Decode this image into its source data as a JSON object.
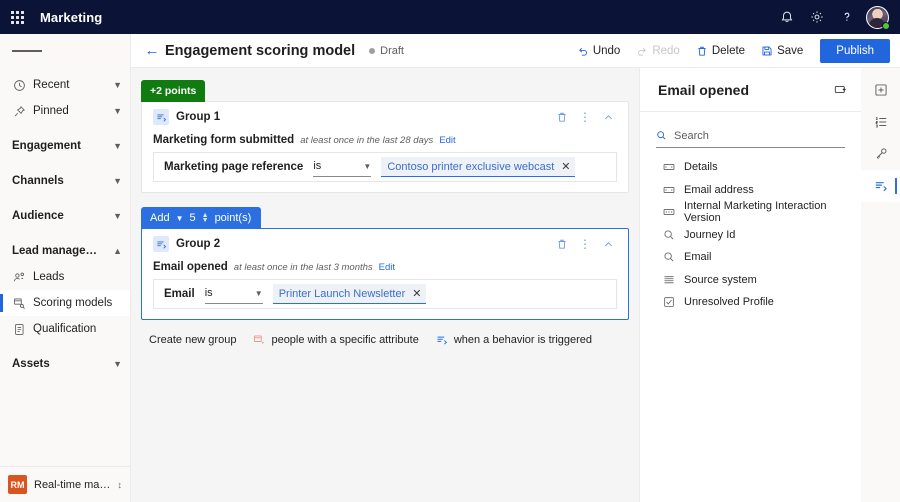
{
  "appbar": {
    "waffle_name": "app-launcher-icon",
    "title": "Marketing",
    "notifications_label": "Notifications",
    "settings_label": "Settings",
    "help_label": "Help"
  },
  "leftnav": {
    "hamburger_label": "Collapse navigation",
    "items": [
      {
        "label": "Recent",
        "icon": "clock-icon",
        "type": "expander",
        "chevron": "down"
      },
      {
        "label": "Pinned",
        "icon": "pin-icon",
        "type": "expander",
        "chevron": "down"
      },
      {
        "label": "Engagement",
        "icon": "",
        "type": "group",
        "chevron": "down"
      },
      {
        "label": "Channels",
        "icon": "",
        "type": "group",
        "chevron": "down"
      },
      {
        "label": "Audience",
        "icon": "",
        "type": "group",
        "chevron": "down"
      },
      {
        "label": "Lead management",
        "icon": "",
        "type": "group",
        "chevron": "up"
      },
      {
        "label": "Leads",
        "icon": "leads-icon",
        "type": "item",
        "chevron": ""
      },
      {
        "label": "Scoring models",
        "icon": "scoring-models-icon",
        "type": "item-selected",
        "chevron": ""
      },
      {
        "label": "Qualification",
        "icon": "qualification-icon",
        "type": "item",
        "chevron": ""
      },
      {
        "label": "Assets",
        "icon": "",
        "type": "group",
        "chevron": "down"
      }
    ],
    "org": {
      "initials": "RM",
      "name": "Real-time marketi...",
      "caret": "⌃"
    }
  },
  "commandbar": {
    "back_label": "Back",
    "title": "Engagement scoring model",
    "status": "Draft",
    "buttons": [
      {
        "label": "Undo",
        "icon": "undo-icon",
        "disabled": false
      },
      {
        "label": "Redo",
        "icon": "redo-icon",
        "disabled": true
      },
      {
        "label": "Delete",
        "icon": "delete-icon",
        "disabled": false
      },
      {
        "label": "Save",
        "icon": "save-icon",
        "disabled": false
      }
    ],
    "publish_label": "Publish"
  },
  "canvas": {
    "groups": [
      {
        "badge": {
          "text": "+2 points",
          "color": "#107c10",
          "style": "green"
        },
        "title": "Group 1",
        "icon": "behavior-trigger-icon",
        "selected": false,
        "condition": {
          "name": "Marketing form submitted",
          "frequency": "at least once in the last 28 days",
          "edit_label": "Edit",
          "field_label": "Marketing page reference",
          "operator": "is",
          "value": "Contoso printer exclusive webcast"
        },
        "actions": [
          "delete-icon",
          "more-options-icon",
          "collapse-chevron-icon"
        ]
      },
      {
        "badge": {
          "text_prefix": "Add",
          "points": "5",
          "text_suffix": "point(s)",
          "color": "#2b6fe0",
          "style": "blue"
        },
        "title": "Group 2",
        "icon": "behavior-trigger-icon",
        "selected": true,
        "condition": {
          "name": "Email opened",
          "frequency": "at least once in the last 3 months",
          "edit_label": "Edit",
          "field_label": "Email",
          "operator": "is",
          "value": "Printer Launch Newsletter"
        },
        "actions": [
          "delete-icon",
          "more-options-icon",
          "collapse-chevron-icon"
        ]
      }
    ],
    "new_group": {
      "label": "Create new group",
      "options": [
        {
          "label": "people with a specific attribute",
          "icon": "attribute-group-icon"
        },
        {
          "label": "when a behavior is triggered",
          "icon": "behavior-trigger-icon"
        }
      ]
    }
  },
  "rightpanel": {
    "title": "Email opened",
    "head_icon": "expand-panel-icon",
    "search": {
      "placeholder": "Search",
      "value": "",
      "icon": "search-icon"
    },
    "items": [
      {
        "label": "Details",
        "icon": "text-field-icon"
      },
      {
        "label": "Email address",
        "icon": "text-field-icon"
      },
      {
        "label": "Internal Marketing Interaction Version",
        "icon": "text-field-icon"
      },
      {
        "label": "Journey Id",
        "icon": "lookup-icon"
      },
      {
        "label": "Email",
        "icon": "lookup-icon"
      },
      {
        "label": "Source system",
        "icon": "list-icon"
      },
      {
        "label": "Unresolved Profile",
        "icon": "checkbox-icon"
      }
    ]
  },
  "rail": {
    "buttons": [
      {
        "name": "add-panel-icon",
        "selected": false
      },
      {
        "name": "ordered-list-icon",
        "selected": false
      },
      {
        "name": "key-icon",
        "selected": false
      },
      {
        "name": "behavior-trigger-icon",
        "selected": true
      }
    ]
  },
  "colors": {
    "brand_blue": "#2266dd",
    "accent_blue": "#2b6fe0",
    "green": "#107c10",
    "navy": "#0b1437",
    "canvas_bg": "#f5f5f5"
  }
}
